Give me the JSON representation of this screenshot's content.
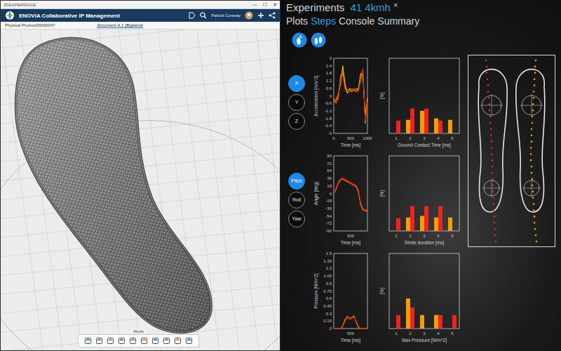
{
  "cad_window": {
    "title": "3DEXPERIENCE",
    "window_controls": [
      "—",
      "☐",
      "✕"
    ],
    "app_title": "ENOVIA Collaborative IP Management",
    "user": "Patrick Conway",
    "breadcrumb": "Physical Product00000347",
    "document_tab": "Document A.1 (Bigband)",
    "toolbar_label": "Mode"
  },
  "experiments": {
    "title": "Experiments",
    "experiment": "41 4kmh",
    "close": "×",
    "tabs": [
      {
        "label": "Plots",
        "selected": false
      },
      {
        "label": "Steps",
        "selected": true
      },
      {
        "label": "Console",
        "selected": false
      },
      {
        "label": "Summary",
        "selected": false
      }
    ],
    "rows": [
      {
        "buttons": [
          {
            "label": "X",
            "selected": true
          },
          {
            "label": "Y",
            "selected": false
          },
          {
            "label": "Z",
            "selected": false
          }
        ],
        "line_chart": {
          "y_label": "Acceleration [m/s^2]",
          "y_ticks": [
            "3",
            "2.4",
            "1.8",
            "1.2",
            "0.6",
            "0",
            "-0.6",
            "-1.2",
            "-1.8",
            "-2.4",
            "-3"
          ],
          "x_label": "Time [ms]",
          "x_ticks": [
            "0",
            "500",
            "1000"
          ],
          "series": [
            {
              "color": "#e8281e",
              "values": [
                -0.3,
                -0.4,
                -0.2,
                1.2,
                2.1,
                0.8,
                0.3,
                0.5,
                0.4,
                0.6,
                0.5,
                0.4,
                1.6,
                2.2,
                -1.8,
                -0.4
              ]
            },
            {
              "color": "#f39c12",
              "values": [
                -0.2,
                -0.6,
                -0.1,
                1.6,
                1.8,
                0.6,
                0.5,
                0.3,
                0.6,
                0.4,
                0.6,
                0.5,
                1.2,
                1.9,
                -2.2,
                -0.6
              ]
            },
            {
              "color": "#f7d117",
              "values": [
                -0.5,
                -0.3,
                0.1,
                0.9,
                2.4,
                1.0,
                0.2,
                0.6,
                0.3,
                0.5,
                0.3,
                0.6,
                1.8,
                1.5,
                -1.5,
                -0.2
              ]
            },
            {
              "color": "#c0150c",
              "values": [
                -0.1,
                -0.5,
                -0.3,
                1.4,
                1.6,
                0.4,
                0.4,
                0.4,
                0.5,
                0.3,
                0.4,
                0.3,
                1.4,
                2.0,
                -2.0,
                -0.5
              ]
            }
          ]
        },
        "bar_chart": {
          "y_label": "[%]",
          "x_label": "Ground Contact Time [ms]",
          "x_ticks": [
            "1",
            "2",
            "3",
            "4",
            "5"
          ],
          "series": [
            {
              "color": "#f39c12",
              "values": [
                0,
                18,
                30,
                20,
                18
              ]
            },
            {
              "color": "#e8281e",
              "values": [
                17,
                33,
                33,
                17,
                0
              ]
            }
          ]
        }
      },
      {
        "buttons": [
          {
            "label": "Pitch",
            "selected": true
          },
          {
            "label": "Roll",
            "selected": false
          },
          {
            "label": "Yaw",
            "selected": false
          }
        ],
        "line_chart": {
          "y_label": "Angle [deg]",
          "y_ticks": [
            "90",
            "72",
            "54",
            "36",
            "18",
            "0",
            "-18",
            "-36",
            "-54",
            "-72",
            "-90"
          ],
          "x_label": "Time [ms]",
          "x_ticks": [
            "500"
          ],
          "series": [
            {
              "color": "#e8281e",
              "values": [
                0,
                12,
                26,
                34,
                36,
                33,
                30,
                27,
                24,
                21,
                18,
                5,
                -25,
                -38,
                -40,
                -40
              ]
            },
            {
              "color": "#f39c12",
              "values": [
                0,
                10,
                24,
                32,
                34,
                31,
                28,
                25,
                22,
                19,
                16,
                2,
                -28,
                -40,
                -42,
                -42
              ]
            },
            {
              "color": "#c0150c",
              "values": [
                2,
                14,
                28,
                36,
                38,
                35,
                32,
                29,
                26,
                23,
                20,
                8,
                -22,
                -36,
                -38,
                -38
              ]
            }
          ]
        },
        "bar_chart": {
          "y_label": "[%]",
          "x_label": "Stride duration [ms]",
          "x_ticks": [
            "1",
            "2",
            "3",
            "4",
            "5"
          ],
          "series": [
            {
              "color": "#f39c12",
              "values": [
                0,
                18,
                20,
                18,
                18
              ]
            },
            {
              "color": "#e8281e",
              "values": [
                17,
                33,
                33,
                33,
                0
              ]
            }
          ]
        }
      },
      {
        "buttons": [],
        "line_chart": {
          "y_label": "Pressure [N/m^2]",
          "y_ticks": [
            "1.5",
            "1.35",
            "1.2",
            "1.05",
            "0.9",
            "0.75",
            "0.6",
            "0.45",
            "0.3",
            "0.15",
            "0"
          ],
          "x_label": "Time [ms]",
          "x_ticks": [
            "500"
          ],
          "series": [
            {
              "color": "#e8281e",
              "values": [
                0,
                0,
                0,
                0,
                0.04,
                0.16,
                0.22,
                0.19,
                0.2,
                0.24,
                0.14,
                0.03,
                0,
                0,
                0,
                0
              ]
            },
            {
              "color": "#f39c12",
              "values": [
                0,
                0,
                0,
                0,
                0.06,
                0.18,
                0.25,
                0.21,
                0.22,
                0.26,
                0.12,
                0.02,
                0,
                0,
                0,
                0
              ]
            },
            {
              "color": "#c0150c",
              "values": [
                0,
                0,
                0,
                0,
                0.03,
                0.14,
                0.2,
                0.18,
                0.19,
                0.22,
                0.16,
                0.05,
                0,
                0,
                0,
                0
              ]
            }
          ]
        },
        "bar_chart": {
          "y_label": "[%]",
          "x_label": "Max Pressure [N/m^2]",
          "x_ticks": [
            "1",
            "2",
            "3",
            "4",
            "5"
          ],
          "series": [
            {
              "color": "#f39c12",
              "values": [
                0,
                40,
                18,
                18,
                0
              ]
            },
            {
              "color": "#e8281e",
              "values": [
                18,
                28,
                0,
                18,
                18
              ]
            }
          ]
        }
      }
    ],
    "foot_map": {
      "feet": [
        {
          "color": "#e8281e",
          "offsets": [
            -8,
            -7,
            -7,
            -6,
            -5,
            -5,
            -4,
            -3,
            -3,
            -2,
            -2,
            -1,
            -1,
            0,
            0,
            0,
            1,
            1,
            1,
            2,
            2,
            2,
            3,
            3,
            3,
            4,
            4,
            5,
            5,
            6
          ]
        },
        {
          "color": "#f39c12",
          "offsets": [
            6,
            5,
            5,
            4,
            4,
            3,
            3,
            2,
            2,
            1,
            1,
            0,
            0,
            0,
            -1,
            -1,
            -1,
            0,
            0,
            1,
            1,
            2,
            2,
            3,
            3,
            4,
            4,
            5,
            6,
            7
          ]
        }
      ]
    }
  }
}
